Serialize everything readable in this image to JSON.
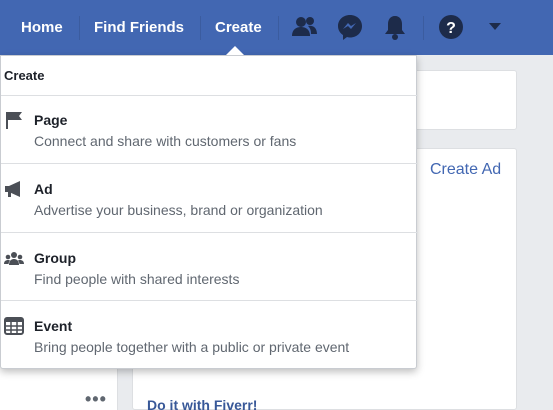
{
  "nav": {
    "home_label": "Home",
    "find_friends_label": "Find Friends",
    "create_label": "Create",
    "icons": [
      "friend-requests-icon",
      "messenger-icon",
      "notifications-icon",
      "help-icon",
      "account-menu-icon"
    ]
  },
  "dropdown": {
    "header": "Create",
    "items": [
      {
        "icon": "flag-icon",
        "title": "Page",
        "description": "Connect and share with customers or fans"
      },
      {
        "icon": "megaphone-icon",
        "title": "Ad",
        "description": "Advertise your business, brand or organization"
      },
      {
        "icon": "group-icon",
        "title": "Group",
        "description": "Find people with shared interests"
      },
      {
        "icon": "calendar-icon",
        "title": "Event",
        "description": "Bring people together with a public or private event"
      }
    ]
  },
  "background": {
    "create_ad_link": "Create Ad",
    "sponsored_title": "Do it with Fiverr!",
    "more_dots": "•••"
  },
  "colors": {
    "brand_blue": "#4267b2",
    "nav_icon_dark": "#1d2b4a",
    "link_blue": "#385898",
    "page_bg": "#e9ebee"
  }
}
